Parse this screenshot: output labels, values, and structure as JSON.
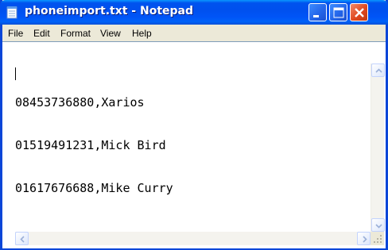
{
  "window": {
    "title": "phoneimport.txt - Notepad",
    "app_icon": "notepad-icon",
    "controls": [
      "minimize-icon",
      "maximize-icon",
      "close-icon"
    ]
  },
  "menu": {
    "items": [
      {
        "label": "File"
      },
      {
        "label": "Edit"
      },
      {
        "label": "Format"
      },
      {
        "label": "View"
      },
      {
        "label": "Help"
      }
    ]
  },
  "document": {
    "lines": [
      "08453736880,Xarios",
      "01519491231,Mick Bird",
      "01617676688,Mike Curry"
    ]
  },
  "colors": {
    "titlebar": "#0053ee",
    "close_button": "#e0481e",
    "menubar": "#ece9d8"
  }
}
